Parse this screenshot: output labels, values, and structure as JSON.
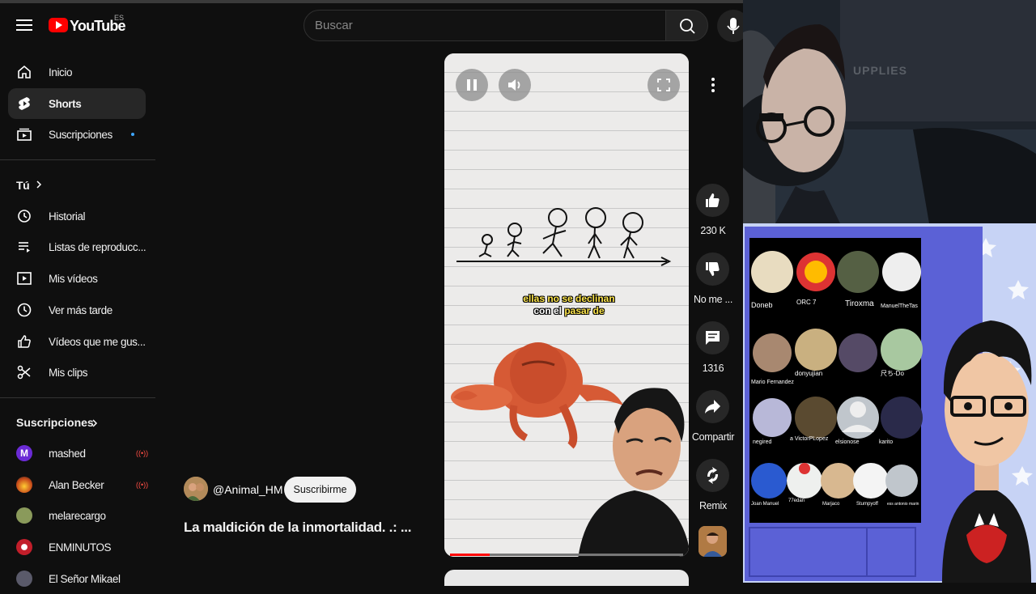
{
  "header": {
    "logo_text": "YouTube",
    "country_code": "ES",
    "search_placeholder": "Buscar"
  },
  "sidebar": {
    "main": [
      {
        "label": "Inicio",
        "icon": "home-icon"
      },
      {
        "label": "Shorts",
        "icon": "shorts-icon",
        "active": true
      },
      {
        "label": "Suscripciones",
        "icon": "subscriptions-icon",
        "new_dot": true
      }
    ],
    "you_section": {
      "title": "Tú",
      "items": [
        {
          "label": "Historial",
          "icon": "history-icon"
        },
        {
          "label": "Listas de reproducc...",
          "icon": "playlists-icon"
        },
        {
          "label": "Mis vídeos",
          "icon": "your-videos-icon"
        },
        {
          "label": "Ver más tarde",
          "icon": "watch-later-icon"
        },
        {
          "label": "Vídeos que me gus...",
          "icon": "liked-videos-icon"
        },
        {
          "label": "Mis clips",
          "icon": "clips-icon"
        }
      ]
    },
    "subscriptions": {
      "title": "Suscripciones",
      "channels": [
        {
          "name": "mashed",
          "live": true,
          "color": "#6b2bd6",
          "initial": "M"
        },
        {
          "name": "Alan Becker",
          "live": true,
          "color": "#c84a1a"
        },
        {
          "name": "melarecargo",
          "live": false,
          "color": "#8a9a5b"
        },
        {
          "name": "ENMINUTOS",
          "live": false,
          "color": "#c21e2a"
        },
        {
          "name": "El Señor Mikael",
          "live": false,
          "color": "#5a5a6a"
        }
      ]
    }
  },
  "short": {
    "caption_line1": "ellas no se declinan",
    "caption_line2_white": "con el ",
    "caption_line2_rest": "pasar de",
    "progress_fraction": 0.17,
    "channel_handle": "@Animal_HM",
    "subscribe_label": "Suscribirme",
    "title": "La maldición de la inmortalidad. .: ..."
  },
  "actions": {
    "likes": "230 K",
    "dislike_label": "No me ...",
    "comments": "1316",
    "share_label": "Compartir",
    "remix_label": "Remix"
  },
  "stream_overlay": {
    "banner_text": "UPPLIES",
    "grid": {
      "row1": [
        "Doneb",
        "ORC 7",
        "Tiroxma",
        "ManuelTheTas"
      ],
      "row2": [
        "Mario Fernandez",
        "donyujian",
        "",
        "尺ち-Do"
      ],
      "row3": [
        "negired",
        "a VictorPLopez",
        "elsionose",
        "karito"
      ],
      "row4": [
        "Joan Manuel",
        "77edan",
        "Marjaco",
        "Stumpyoff",
        "ess antonio marin"
      ]
    }
  },
  "colors": {
    "background": "#0f0f0f",
    "accent_red": "#ff0000",
    "active_item": "#272727",
    "text": "#f1f1f1"
  }
}
